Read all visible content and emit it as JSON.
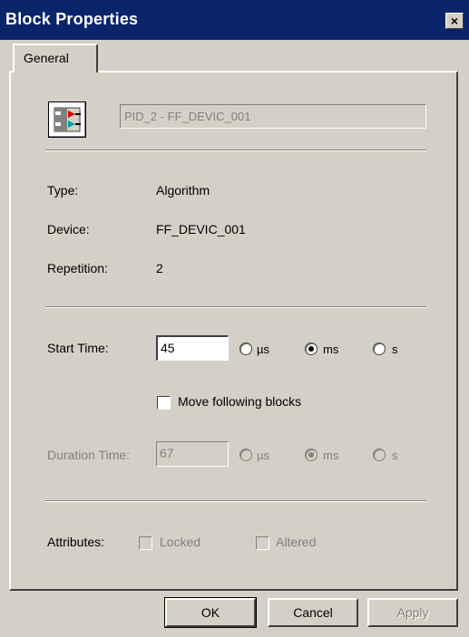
{
  "window": {
    "title": "Block Properties",
    "close_label": "×"
  },
  "tabs": [
    {
      "label": "General"
    }
  ],
  "block": {
    "icon": "function-block-icon",
    "name": "PID_2 - FF_DEVIC_001"
  },
  "info": {
    "type_label": "Type:",
    "type_value": "Algorithm",
    "device_label": "Device:",
    "device_value": "FF_DEVIC_001",
    "repetition_label": "Repetition:",
    "repetition_value": "2"
  },
  "start_time": {
    "label": "Start Time:",
    "value": "45",
    "units": [
      "µs",
      "ms",
      "s"
    ],
    "selected_unit": "ms"
  },
  "move_following": {
    "label": "Move following blocks",
    "checked": false
  },
  "duration_time": {
    "label": "Duration Time:",
    "value": "67",
    "units": [
      "µs",
      "ms",
      "s"
    ],
    "selected_unit": "ms"
  },
  "attributes": {
    "label": "Attributes:",
    "locked_label": "Locked",
    "altered_label": "Altered"
  },
  "buttons": {
    "ok": "OK",
    "cancel": "Cancel",
    "apply": "Apply"
  }
}
